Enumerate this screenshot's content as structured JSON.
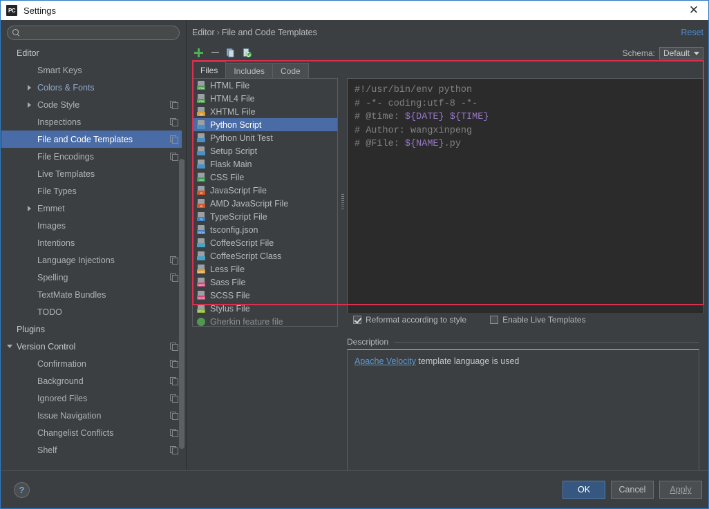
{
  "window": {
    "title": "Settings",
    "app_icon": "PC",
    "close_icon": "✕"
  },
  "sidebar": {
    "search": {
      "value": "",
      "placeholder": ""
    },
    "items": [
      {
        "label": "Editor",
        "level": 0,
        "arrow": "none",
        "badge": false,
        "selected": false,
        "accent": false
      },
      {
        "label": "Smart Keys",
        "level": 1,
        "arrow": "none",
        "badge": false,
        "selected": false,
        "accent": false
      },
      {
        "label": "Colors & Fonts",
        "level": 1,
        "arrow": "right",
        "badge": false,
        "selected": false,
        "accent": true
      },
      {
        "label": "Code Style",
        "level": 1,
        "arrow": "right",
        "badge": true,
        "selected": false,
        "accent": false
      },
      {
        "label": "Inspections",
        "level": 1,
        "arrow": "none",
        "badge": true,
        "selected": false,
        "accent": false
      },
      {
        "label": "File and Code Templates",
        "level": 1,
        "arrow": "none",
        "badge": true,
        "selected": true,
        "accent": false
      },
      {
        "label": "File Encodings",
        "level": 1,
        "arrow": "none",
        "badge": true,
        "selected": false,
        "accent": false
      },
      {
        "label": "Live Templates",
        "level": 1,
        "arrow": "none",
        "badge": false,
        "selected": false,
        "accent": false
      },
      {
        "label": "File Types",
        "level": 1,
        "arrow": "none",
        "badge": false,
        "selected": false,
        "accent": false
      },
      {
        "label": "Emmet",
        "level": 1,
        "arrow": "right",
        "badge": false,
        "selected": false,
        "accent": false
      },
      {
        "label": "Images",
        "level": 1,
        "arrow": "none",
        "badge": false,
        "selected": false,
        "accent": false
      },
      {
        "label": "Intentions",
        "level": 1,
        "arrow": "none",
        "badge": false,
        "selected": false,
        "accent": false
      },
      {
        "label": "Language Injections",
        "level": 1,
        "arrow": "none",
        "badge": true,
        "selected": false,
        "accent": false
      },
      {
        "label": "Spelling",
        "level": 1,
        "arrow": "none",
        "badge": true,
        "selected": false,
        "accent": false
      },
      {
        "label": "TextMate Bundles",
        "level": 1,
        "arrow": "none",
        "badge": false,
        "selected": false,
        "accent": false
      },
      {
        "label": "TODO",
        "level": 1,
        "arrow": "none",
        "badge": false,
        "selected": false,
        "accent": false
      },
      {
        "label": "Plugins",
        "level": 0,
        "arrow": "none",
        "badge": false,
        "selected": false,
        "accent": false
      },
      {
        "label": "Version Control",
        "level": 0,
        "arrow": "down",
        "badge": true,
        "selected": false,
        "accent": false
      },
      {
        "label": "Confirmation",
        "level": 1,
        "arrow": "none",
        "badge": true,
        "selected": false,
        "accent": false
      },
      {
        "label": "Background",
        "level": 1,
        "arrow": "none",
        "badge": true,
        "selected": false,
        "accent": false
      },
      {
        "label": "Ignored Files",
        "level": 1,
        "arrow": "none",
        "badge": true,
        "selected": false,
        "accent": false
      },
      {
        "label": "Issue Navigation",
        "level": 1,
        "arrow": "none",
        "badge": true,
        "selected": false,
        "accent": false
      },
      {
        "label": "Changelist Conflicts",
        "level": 1,
        "arrow": "none",
        "badge": true,
        "selected": false,
        "accent": false
      },
      {
        "label": "Shelf",
        "level": 1,
        "arrow": "none",
        "badge": true,
        "selected": false,
        "accent": false
      }
    ]
  },
  "content": {
    "breadcrumb": {
      "root": "Editor",
      "separator": "›",
      "leaf": "File and Code Templates"
    },
    "reset_link": "Reset",
    "toolbar": {
      "add_title": "Add",
      "remove_title": "Remove",
      "copy_title": "Copy",
      "reset_template_title": "Reset To Default"
    },
    "schema": {
      "label": "Schema:",
      "value": "Default",
      "arrow": "▼"
    },
    "tabs": [
      {
        "label": "Files",
        "active": true
      },
      {
        "label": "Includes",
        "active": false
      },
      {
        "label": "Code",
        "active": false
      }
    ],
    "file_list": [
      {
        "label": "HTML File",
        "icon": "html-file-icon",
        "badge_text": "HTML",
        "badge_color": "#4f9a4f",
        "selected": false,
        "dim": false
      },
      {
        "label": "HTML4 File",
        "icon": "html4-file-icon",
        "badge_text": "HTML",
        "badge_color": "#4f9a4f",
        "selected": false,
        "dim": false
      },
      {
        "label": "XHTML File",
        "icon": "xhtml-file-icon",
        "badge_text": "XH",
        "badge_color": "#d79b3a",
        "selected": false,
        "dim": false
      },
      {
        "label": "Python Script",
        "icon": "python-script-icon",
        "badge_text": "",
        "badge_color": "#4a90c4",
        "selected": true,
        "dim": false
      },
      {
        "label": "Python Unit Test",
        "icon": "python-unittest-icon",
        "badge_text": "",
        "badge_color": "#4a90c4",
        "selected": false,
        "dim": false
      },
      {
        "label": "Setup Script",
        "icon": "setup-script-icon",
        "badge_text": "",
        "badge_color": "#4a90c4",
        "selected": false,
        "dim": false
      },
      {
        "label": "Flask Main",
        "icon": "flask-main-icon",
        "badge_text": "",
        "badge_color": "#4a90c4",
        "selected": false,
        "dim": false
      },
      {
        "label": "CSS File",
        "icon": "css-file-icon",
        "badge_text": "CSS",
        "badge_color": "#3c9a52",
        "selected": false,
        "dim": false
      },
      {
        "label": "JavaScript File",
        "icon": "javascript-file-icon",
        "badge_text": "JS",
        "badge_color": "#d4552c",
        "selected": false,
        "dim": false
      },
      {
        "label": "AMD JavaScript File",
        "icon": "amd-javascript-icon",
        "badge_text": "JS",
        "badge_color": "#d4552c",
        "selected": false,
        "dim": false
      },
      {
        "label": "TypeScript File",
        "icon": "typescript-file-icon",
        "badge_text": "TS",
        "badge_color": "#3f7fc1",
        "selected": false,
        "dim": false
      },
      {
        "label": "tsconfig.json",
        "icon": "tsconfig-json-icon",
        "badge_text": "JSON",
        "badge_color": "#3f7fc1",
        "selected": false,
        "dim": false
      },
      {
        "label": "CoffeeScript File",
        "icon": "coffeescript-file-icon",
        "badge_text": "",
        "badge_color": "#4aa3c4",
        "selected": false,
        "dim": false
      },
      {
        "label": "CoffeeScript Class",
        "icon": "coffeescript-class-icon",
        "badge_text": "",
        "badge_color": "#4aa3c4",
        "selected": false,
        "dim": false
      },
      {
        "label": "Less File",
        "icon": "less-file-icon",
        "badge_text": "LESS",
        "badge_color": "#d79b3a",
        "selected": false,
        "dim": false
      },
      {
        "label": "Sass File",
        "icon": "sass-file-icon",
        "badge_text": "SASS",
        "badge_color": "#cf4a7a",
        "selected": false,
        "dim": false
      },
      {
        "label": "SCSS File",
        "icon": "scss-file-icon",
        "badge_text": "SCSS",
        "badge_color": "#cf4a7a",
        "selected": false,
        "dim": false
      },
      {
        "label": "Stylus File",
        "icon": "stylus-file-icon",
        "badge_text": "STYL",
        "badge_color": "#8fae3c",
        "selected": false,
        "dim": false
      },
      {
        "label": "Gherkin feature file",
        "icon": "gherkin-feature-icon",
        "badge_text": "",
        "badge_color": "#4f9a4f",
        "selected": false,
        "dim": true
      }
    ],
    "editor": {
      "lines": [
        "#!/usr/bin/env python",
        "# -*- coding:utf-8 -*-",
        "# @time: ${DATE} ${TIME}",
        "# Author: wangxinpeng",
        "# @File: ${NAME}.py"
      ],
      "variable_color": "#9876c8",
      "comment_color": "#7f837f"
    },
    "checkboxes": [
      {
        "label": "Reformat according to style",
        "checked": true
      },
      {
        "label": "Enable Live Templates",
        "checked": false
      }
    ],
    "description": {
      "title": "Description",
      "link_text": "Apache Velocity",
      "rest_text": " template language is used"
    }
  },
  "footer": {
    "help_label": "?",
    "ok_label": "OK",
    "cancel_label": "Cancel",
    "apply_label": "Apply"
  },
  "annotation": {
    "color": "#d9304f"
  }
}
